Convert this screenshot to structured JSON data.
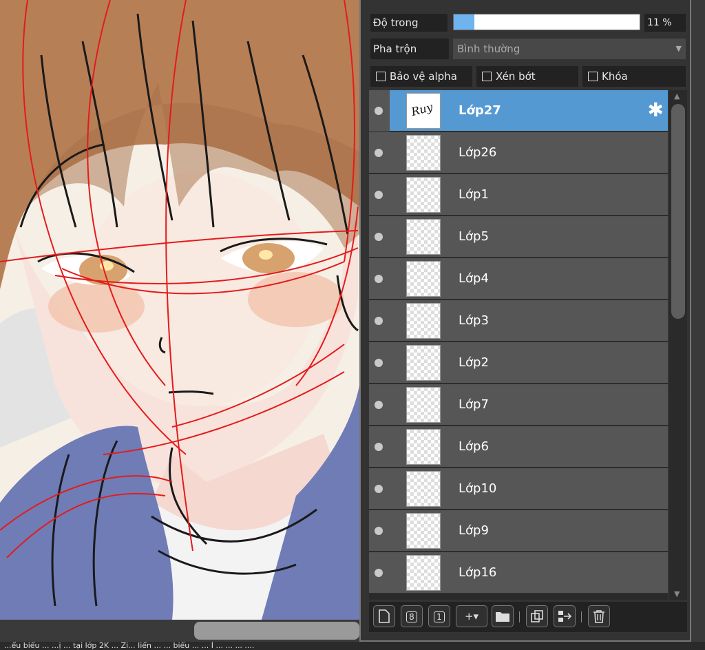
{
  "layer_panel": {
    "opacity": {
      "label": "Độ trong",
      "value_text": "11 %",
      "fraction": 0.11,
      "fill_color": "#6fb3ef"
    },
    "blend": {
      "label": "Pha trộn",
      "value": "Bình thường"
    },
    "options": [
      {
        "label": "Bảo vệ alpha",
        "checked": false
      },
      {
        "label": "Xén bớt",
        "checked": false
      },
      {
        "label": "Khóa",
        "checked": false
      }
    ],
    "layers": [
      {
        "name": "Lớp27",
        "selected": true,
        "thumb_text": "Ruy"
      },
      {
        "name": "Lớp26",
        "selected": false,
        "thumb_text": ""
      },
      {
        "name": "Lớp1",
        "selected": false,
        "thumb_text": ""
      },
      {
        "name": "Lớp5",
        "selected": false,
        "thumb_text": ""
      },
      {
        "name": "Lớp4",
        "selected": false,
        "thumb_text": ""
      },
      {
        "name": "Lớp3",
        "selected": false,
        "thumb_text": ""
      },
      {
        "name": "Lớp2",
        "selected": false,
        "thumb_text": ""
      },
      {
        "name": "Lớp7",
        "selected": false,
        "thumb_text": ""
      },
      {
        "name": "Lớp6",
        "selected": false,
        "thumb_text": ""
      },
      {
        "name": "Lớp10",
        "selected": false,
        "thumb_text": ""
      },
      {
        "name": "Lớp9",
        "selected": false,
        "thumb_text": ""
      },
      {
        "name": "Lớp16",
        "selected": false,
        "thumb_text": ""
      }
    ],
    "selected_color": "#5599d3",
    "toolbar_icons": [
      "new-layer-icon",
      "new-8bit-layer-icon",
      "new-1bit-layer-icon",
      "add-layer-dropdown-icon",
      "new-folder-icon",
      "duplicate-layer-icon",
      "merge-down-icon",
      "delete-layer-icon"
    ],
    "toolbar_glyphs": {
      "b8": "8",
      "b1": "1",
      "plus": "+▾"
    }
  },
  "status": {
    "text": "...ểu biểu ... ...ị ... tại lớp 2K ... Zi... liển ... ... biểu ... ... Ì ... ... ... ...."
  }
}
